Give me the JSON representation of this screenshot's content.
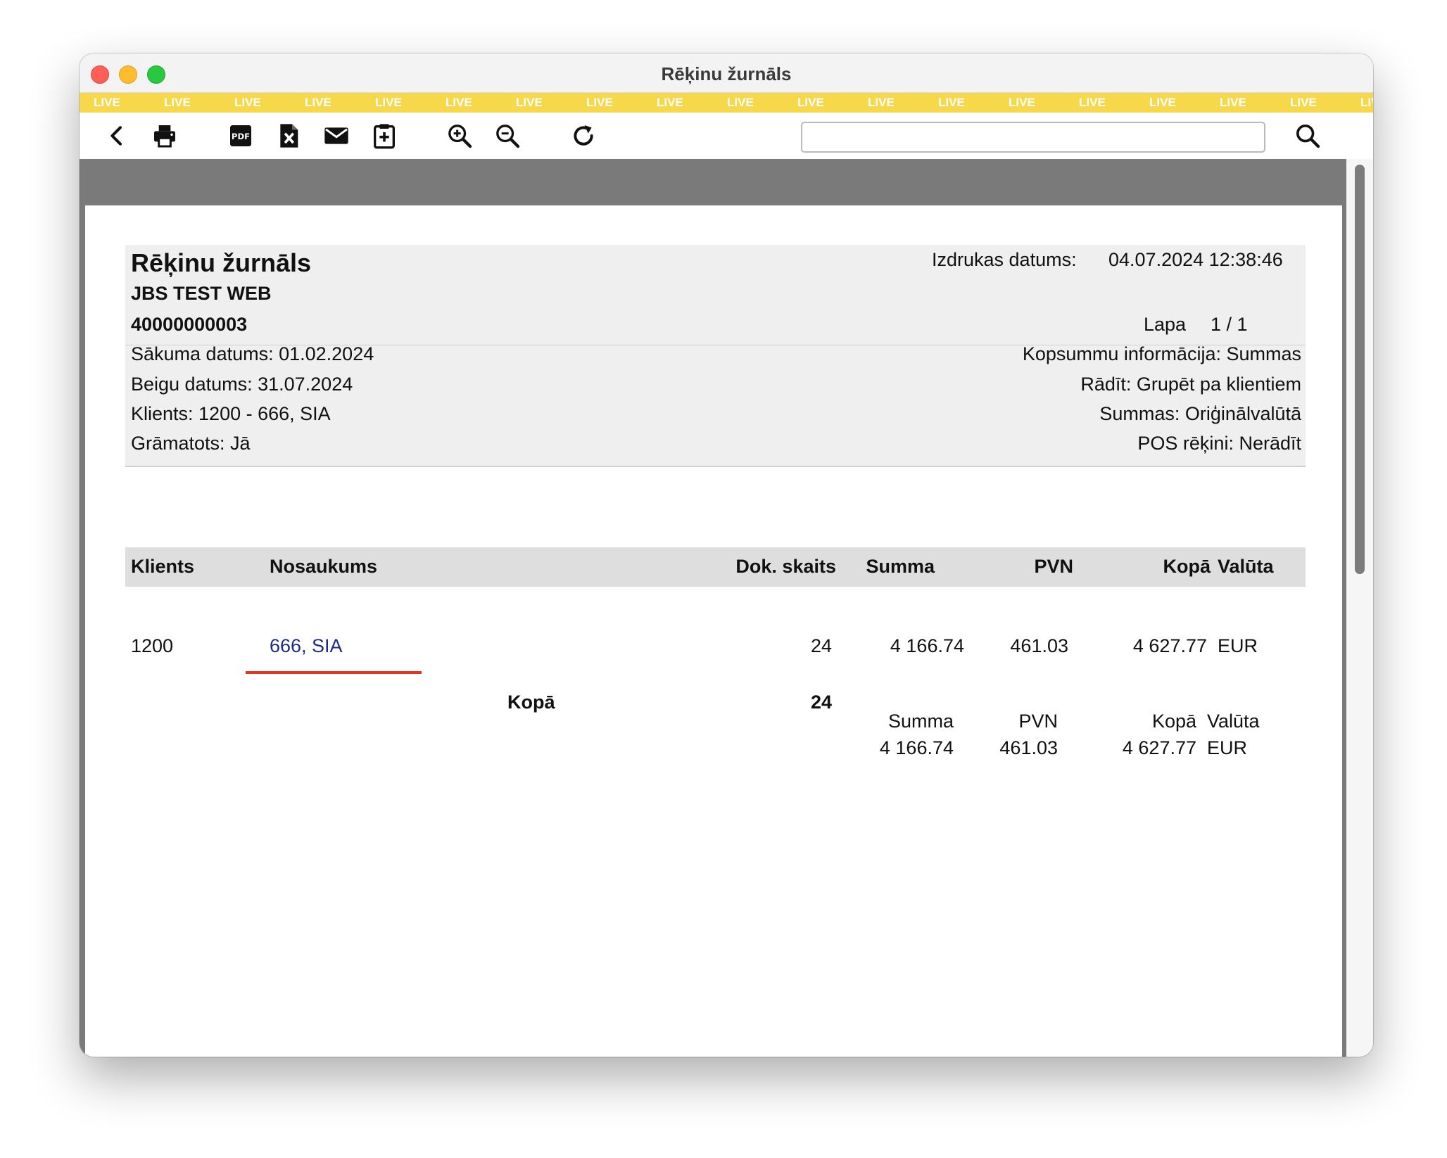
{
  "window": {
    "title": "Rēķinu žurnāls"
  },
  "live_strip": {
    "label": "LIVE"
  },
  "toolbar": {
    "buttons": [
      {
        "name": "back-button",
        "icon": "chevron-left-icon"
      },
      {
        "name": "print-button",
        "icon": "printer-icon"
      },
      {
        "name": "pdf-button",
        "icon": "pdf-icon"
      },
      {
        "name": "excel-button",
        "icon": "excel-file-icon"
      },
      {
        "name": "email-button",
        "icon": "envelope-icon"
      },
      {
        "name": "clipboard-add-button",
        "icon": "clipboard-plus-icon"
      },
      {
        "name": "zoom-in-button",
        "icon": "zoom-in-icon"
      },
      {
        "name": "zoom-out-button",
        "icon": "zoom-out-icon"
      },
      {
        "name": "refresh-button",
        "icon": "refresh-icon"
      }
    ],
    "search": {
      "value": "",
      "placeholder": ""
    },
    "search_icon": "search-icon"
  },
  "report": {
    "title": "Rēķinu žurnāls",
    "company": "JBS TEST WEB",
    "reg_no": "40000000003",
    "print_date_label": "Izdrukas datums:",
    "print_date_value": "04.07.2024 12:38:46",
    "page_label": "Lapa",
    "page_value": "1 / 1",
    "filters_left": [
      "Sākuma datums: 01.02.2024",
      "Beigu datums: 31.07.2024",
      "Klients: 1200 - 666, SIA",
      "Grāmatots: Jā"
    ],
    "filters_right": [
      "Kopsummu informācija: Summas",
      "Rādīt: Grupēt pa klientiem",
      "Summas: Oriģinālvalūtā",
      "POS rēķini: Nerādīt"
    ],
    "table": {
      "headers": {
        "client": "Klients",
        "name": "Nosaukums",
        "doc_count": "Dok. skaits",
        "sum": "Summa",
        "vat": "PVN",
        "total": "Kopā",
        "currency": "Valūta"
      },
      "rows": [
        {
          "client": "1200",
          "name": "666, SIA",
          "doc_count": "24",
          "sum": "4 166.74",
          "vat": "461.03",
          "total": "4 627.77",
          "currency": "EUR"
        }
      ]
    },
    "totals": {
      "label": "Kopā",
      "doc_count": "24",
      "headers": {
        "sum": "Summa",
        "vat": "PVN",
        "total": "Kopā",
        "currency": "Valūta"
      },
      "values": {
        "sum": "4 166.74",
        "vat": "461.03",
        "total": "4 627.77",
        "currency": "EUR"
      }
    }
  },
  "colors": {
    "live_strip": "#f7d84a",
    "link": "#1c2a8c",
    "underline": "#e53423"
  }
}
